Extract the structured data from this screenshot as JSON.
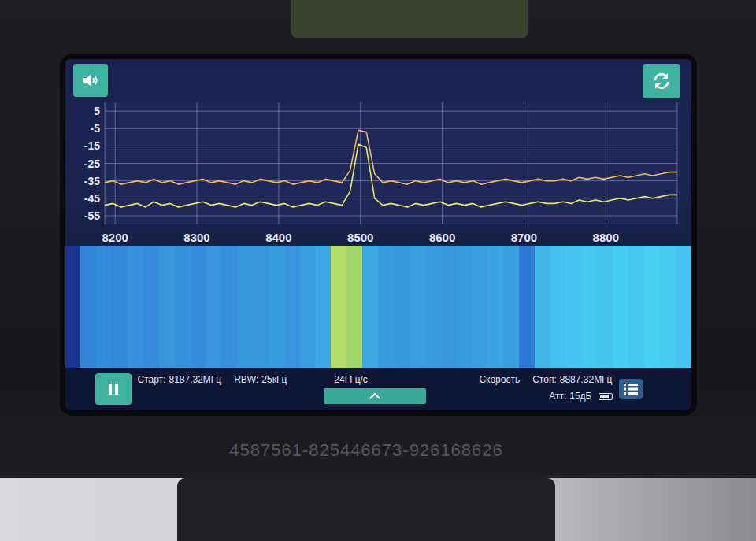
{
  "chart": {
    "y_axis": {
      "ticks": [
        "5",
        "-5",
        "-15",
        "-25",
        "-35",
        "-45",
        "-55"
      ]
    },
    "x_axis": {
      "ticks": [
        "8200",
        "8300",
        "8400",
        "8500",
        "8600",
        "8700",
        "8800"
      ]
    },
    "series": [
      {
        "color": "#f2b860",
        "values": [
          -36,
          -35,
          -37,
          -36,
          -35,
          -36,
          -34,
          -36,
          -35,
          -37,
          -36,
          -35,
          -34,
          -36,
          -35,
          -36,
          -37,
          -35,
          -36,
          -34,
          -35,
          -36,
          -35,
          -37,
          -36,
          -35,
          -36,
          -34,
          -35,
          -36,
          -29,
          -6,
          -7,
          -31,
          -36,
          -35,
          -36,
          -37,
          -35,
          -36,
          -35,
          -34,
          -36,
          -35,
          -36,
          -35,
          -37,
          -36,
          -35,
          -34,
          -35,
          -36,
          -35,
          -34,
          -35,
          -35,
          -34,
          -35,
          -33,
          -34,
          -33,
          -34,
          -33,
          -32,
          -33,
          -32,
          -31,
          -32,
          -31,
          -30,
          -30
        ]
      },
      {
        "color": "#e6ea5c",
        "values": [
          -49,
          -48,
          -50,
          -49,
          -48,
          -50,
          -47,
          -49,
          -48,
          -50,
          -49,
          -48,
          -47,
          -49,
          -48,
          -49,
          -50,
          -48,
          -49,
          -47,
          -48,
          -49,
          -48,
          -50,
          -49,
          -48,
          -49,
          -47,
          -48,
          -49,
          -41,
          -14,
          -16,
          -45,
          -49,
          -48,
          -49,
          -50,
          -48,
          -49,
          -48,
          -47,
          -49,
          -48,
          -49,
          -48,
          -50,
          -49,
          -48,
          -47,
          -48,
          -49,
          -48,
          -47,
          -48,
          -48,
          -47,
          -48,
          -46,
          -47,
          -46,
          -47,
          -46,
          -45,
          -46,
          -45,
          -44,
          -45,
          -44,
          -43,
          -43
        ]
      }
    ]
  },
  "waterfall": {
    "levels": [
      0.1,
      0.35,
      0.4,
      0.38,
      0.42,
      0.4,
      0.45,
      0.43,
      0.4,
      0.44,
      0.42,
      0.46,
      0.45,
      0.48,
      0.44,
      0.5,
      0.55,
      0.95,
      0.9,
      0.55,
      0.48,
      0.46,
      0.5,
      0.47,
      0.45,
      0.48,
      0.5,
      0.52,
      0.5,
      0.3,
      0.62,
      0.68,
      0.7,
      0.72,
      0.7,
      0.74,
      0.72,
      0.75,
      0.73,
      0.7
    ]
  },
  "status_bar": {
    "start": {
      "label": "Старт:",
      "value": "8187.32МГц"
    },
    "rbw": {
      "label": "RBW:",
      "value": "25кГц"
    },
    "speed_value": "24ГГц/с",
    "speed_label": "Скорость",
    "stop": {
      "label": "Стоп:",
      "value": "8887.32МГц"
    },
    "attenuation": {
      "label": "Атт:",
      "value": "15дБ"
    },
    "battery": {
      "level": 0.8
    }
  },
  "serial": "4587561-825446673-926168626"
}
